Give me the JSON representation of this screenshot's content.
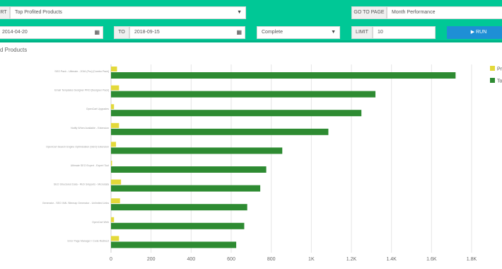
{
  "toolbar": {
    "report_label": "RT",
    "report_value": "Top Profited Products",
    "goto_label": "GO TO PAGE",
    "goto_value": "Month Performance",
    "from_value": "2014-04-20",
    "to_label": "TO",
    "to_value": "2018-09-15",
    "status_value": "Complete",
    "limit_label": "LIMIT",
    "limit_value": "10",
    "run_label": "▶ RUN",
    "icons": {
      "calendar": "calendar-icon",
      "caret": "caret-down-icon"
    }
  },
  "chart_data": {
    "type": "bar",
    "orientation": "horizontal",
    "title": "d Products",
    "categories": [
      "SEO Pack - Ultimate - 2016 (Pro) [Combo Pack]",
      "Email Templates Designer PRO [Designer Pack]",
      "OpenCart Upgrades",
      "Notify When Available - Extension",
      "OpenCart Search Engine Optimization (SEO) Extension",
      "Ultimate SEO Expert - Expert Tool",
      "SEO Structured Data - Rich Snippets - Microdata",
      "Generator - SEO XML Sitemap Generator - Unlimited Links",
      "OpenCart Web",
      "Error Page Manager / Code Redirect"
    ],
    "series": [
      {
        "name": "Pr",
        "color": "#e3d93a",
        "values": [
          30,
          40,
          15,
          40,
          25,
          5,
          50,
          45,
          15,
          40
        ]
      },
      {
        "name": "To",
        "color": "#2e8b32",
        "values": [
          1720,
          1320,
          1250,
          1085,
          855,
          775,
          745,
          680,
          665,
          625
        ]
      }
    ],
    "xlim": [
      0,
      1800
    ],
    "xticks": [
      "0",
      "200",
      "400",
      "600",
      "800",
      "1K",
      "1.2K",
      "1.4K",
      "1.6K",
      "1.8K"
    ],
    "grid": true,
    "legend": "right"
  }
}
